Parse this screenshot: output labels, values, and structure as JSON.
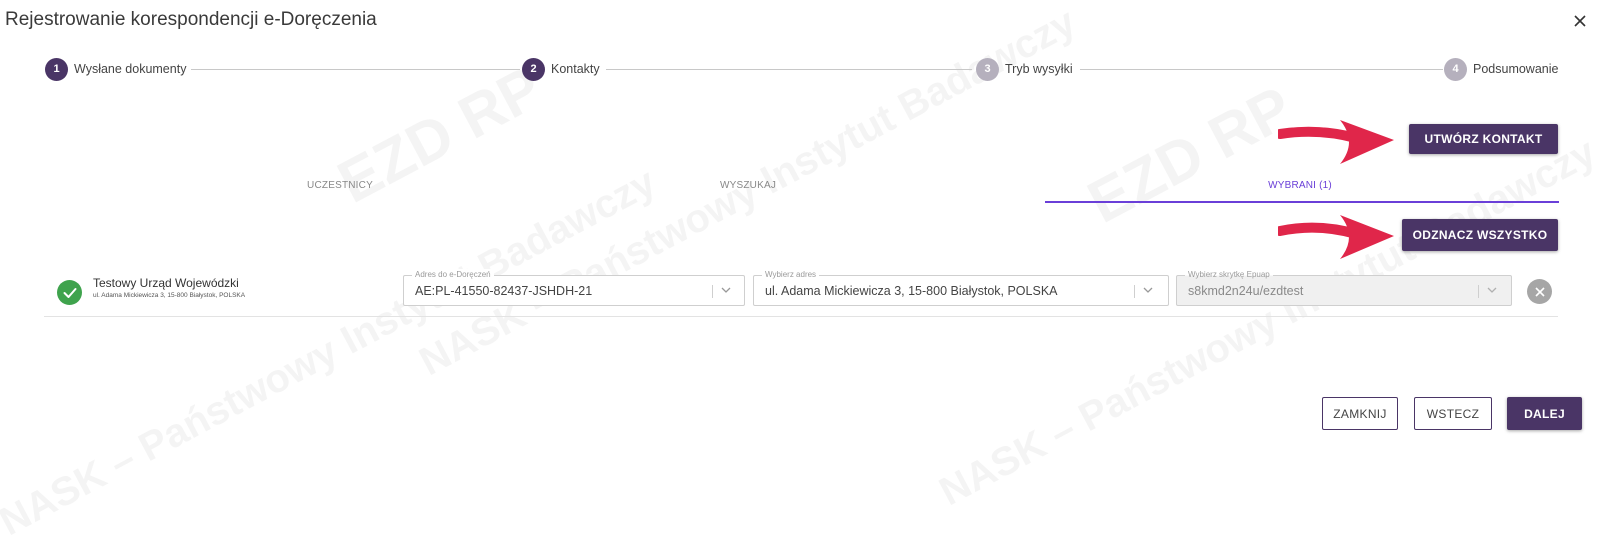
{
  "dialog": {
    "title": "Rejestrowanie korespondencji e-Doręczenia"
  },
  "stepper": [
    {
      "number": "1",
      "label": "Wysłane dokumenty",
      "state": "done"
    },
    {
      "number": "2",
      "label": "Kontakty",
      "state": "current"
    },
    {
      "number": "3",
      "label": "Tryb wysyłki",
      "state": "pending"
    },
    {
      "number": "4",
      "label": "Podsumowanie",
      "state": "pending"
    }
  ],
  "actions": {
    "create_contact": "UTWÓRZ KONTAKT",
    "deselect_all": "ODZNACZ WSZYSTKO"
  },
  "tabs": [
    {
      "label": "UCZESTNICY",
      "active": false
    },
    {
      "label": "WYSZUKAJ",
      "active": false
    },
    {
      "label": "WYBRANI (1)",
      "active": true
    }
  ],
  "selected": [
    {
      "name": "Testowy Urząd Wojewódzki",
      "address": "ul. Adama Mickiewicza 3, 15-800 Białystok, POLSKA",
      "fields": {
        "edelivery": {
          "label": "Adres do e-Doręczeń",
          "value": "AE:PL-41550-82437-JSHDH-21"
        },
        "address": {
          "label": "Wybierz adres",
          "value": "ul. Adama Mickiewicza 3, 15-800 Białystok, POLSKA"
        },
        "epuap": {
          "label": "Wybierz skrytkę Epuap",
          "value": "s8kmd2n24u/ezdtest"
        }
      }
    }
  ],
  "footer": {
    "close": "ZAMKNIJ",
    "back": "WSTECZ",
    "next": "DALEJ"
  },
  "watermark": {
    "brand": "EZD RP",
    "org": "NASK – Państwowy Instytut Badawczy"
  },
  "colors": {
    "primary": "#4a3566",
    "accent": "#6a3fd8",
    "success": "#3fa34d",
    "arrow": "#e0264a"
  }
}
